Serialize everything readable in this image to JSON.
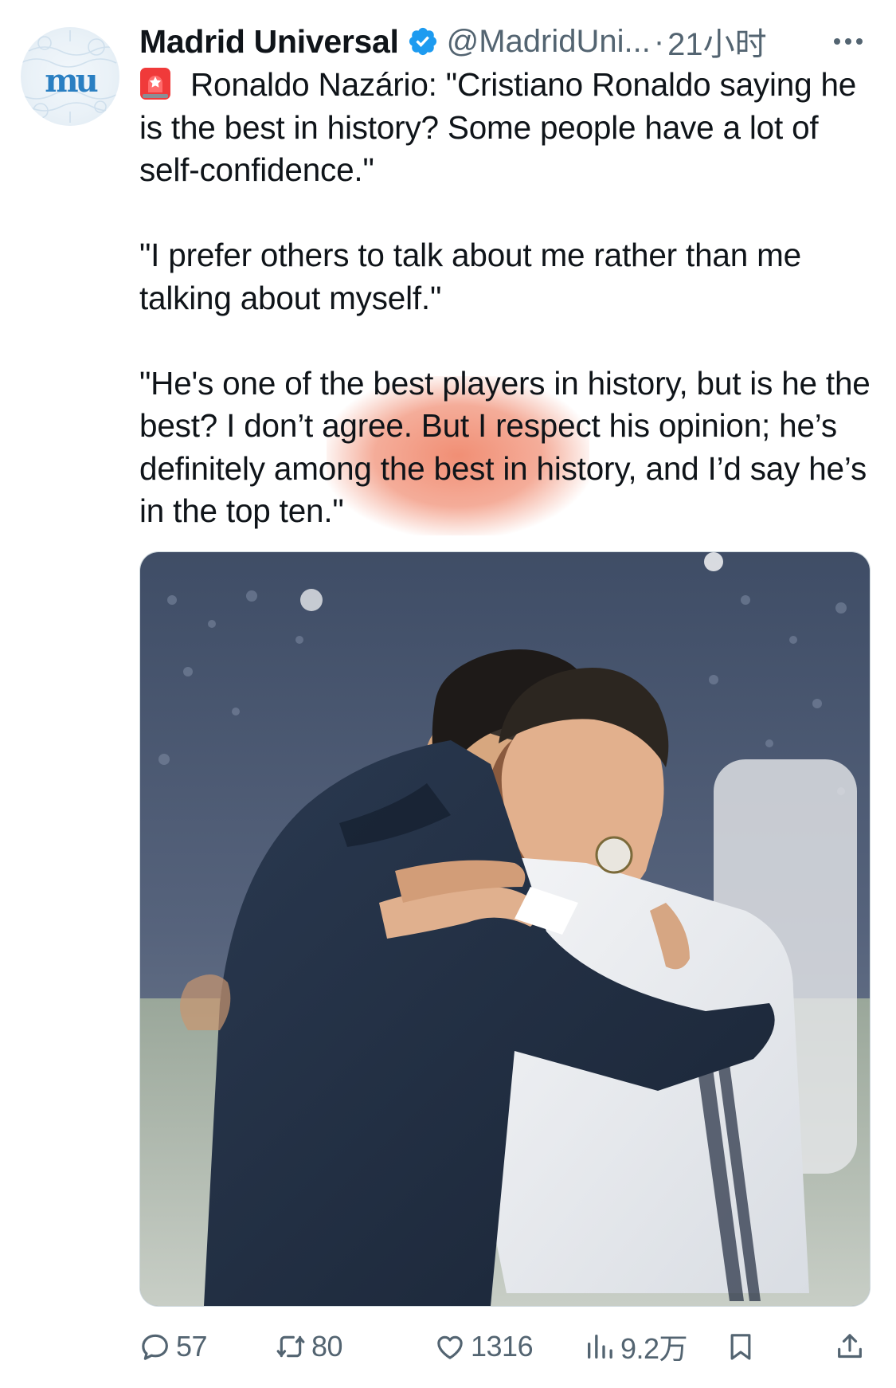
{
  "tweet": {
    "author_name": "Madrid Universal",
    "handle": "@MadridUni...",
    "separator": "·",
    "timestamp": "21小时",
    "avatar_text": "mu",
    "paragraphs": [
      {
        "text": "Ronaldo Nazário: \"Cristiano Ronaldo saying he is the best in history? Some people have a lot of self-confidence.\""
      },
      {
        "text": "\"I prefer others to talk about me rather than me talking about myself.\""
      },
      {
        "text": "\"He's one of the best players in history, but is he the best? I don’t agree. But I respect his opinion; he’s definitely among the best in history, and I’d say he’s in the top ten.\""
      }
    ],
    "actions": {
      "replies": "57",
      "retweets": "80",
      "likes": "1316",
      "views": "9.2万"
    }
  },
  "colors": {
    "text": "#0f1419",
    "secondary": "#536471",
    "verified": "#1d9bf0",
    "highlight": "#ec6946"
  },
  "icons": {
    "verified": "verified-badge-icon",
    "more": "more-horizontal-icon",
    "siren": "rotating-light-emoji",
    "reply": "reply-icon",
    "retweet": "retweet-icon",
    "like": "heart-icon",
    "views": "bar-chart-icon",
    "bookmark": "bookmark-icon",
    "share": "share-icon"
  }
}
